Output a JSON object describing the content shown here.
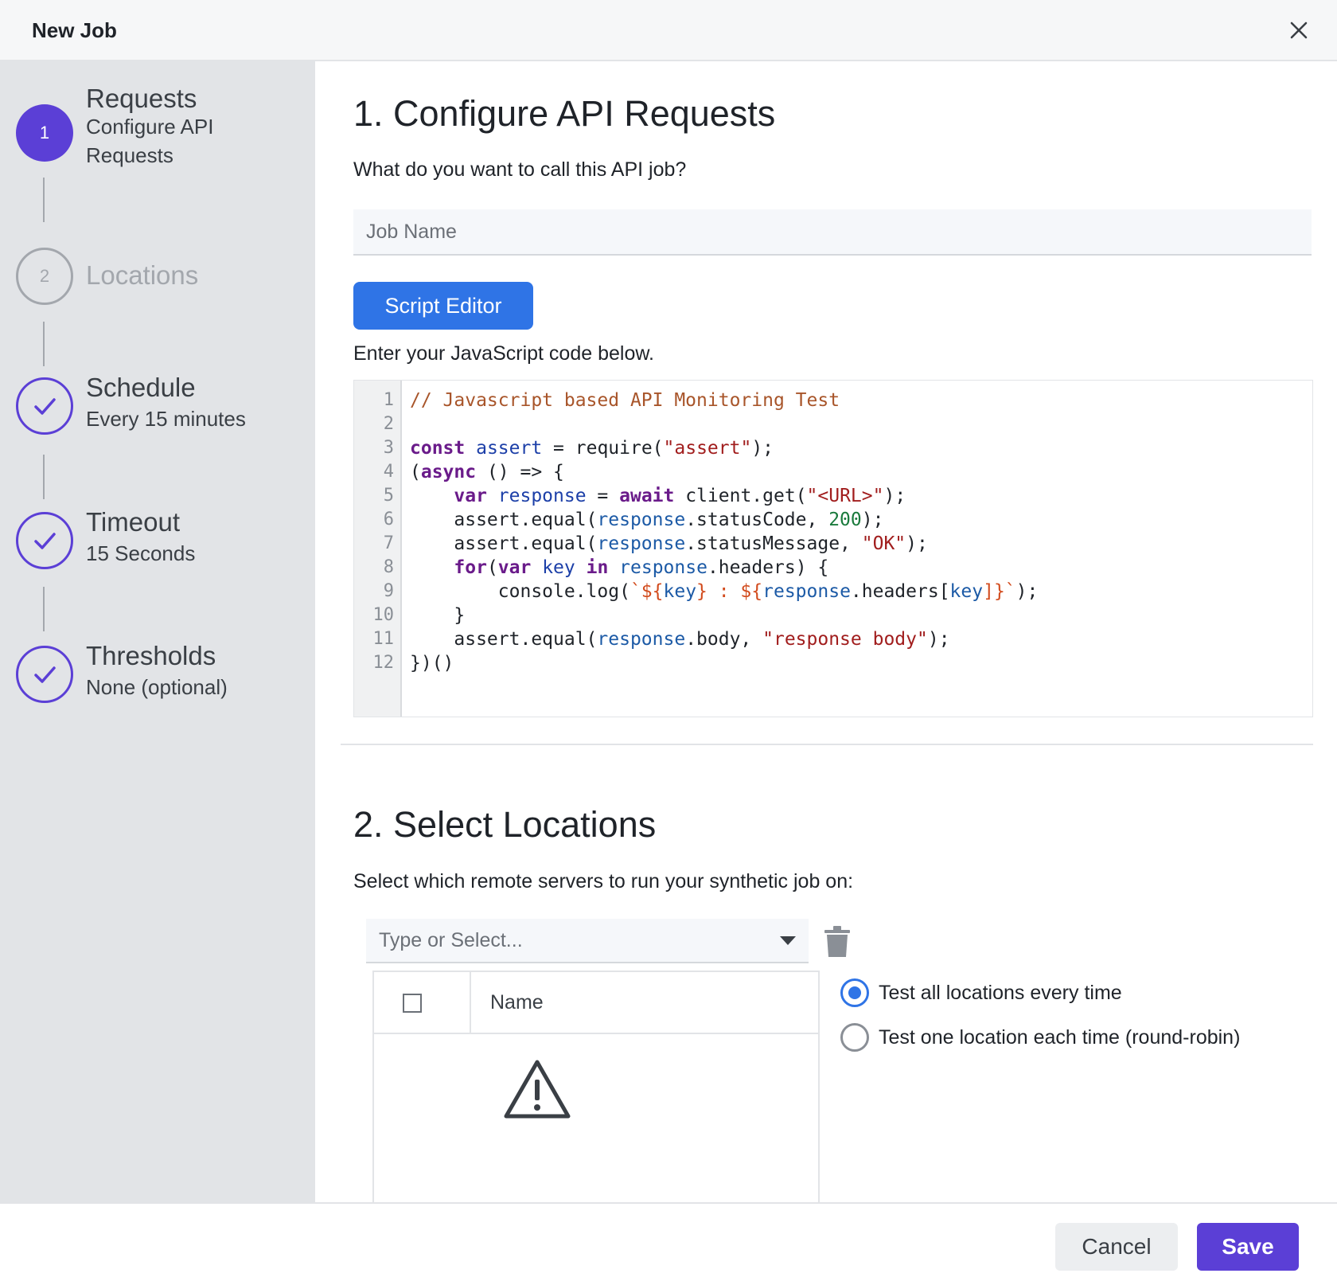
{
  "window": {
    "title": "New Job"
  },
  "steps": [
    {
      "number": "1",
      "name": "Requests",
      "sub": "Configure API Requests",
      "state": "active"
    },
    {
      "number": "2",
      "name": "Locations",
      "sub": "",
      "state": "todo"
    },
    {
      "number": "",
      "name": "Schedule",
      "sub": "Every 15 minutes",
      "state": "done"
    },
    {
      "number": "",
      "name": "Timeout",
      "sub": "15 Seconds",
      "state": "done"
    },
    {
      "number": "",
      "name": "Thresholds",
      "sub": "None (optional)",
      "state": "done"
    }
  ],
  "requests": {
    "heading": "1. Configure API Requests",
    "question": "What do you want to call this API job?",
    "job_name_placeholder": "Job Name",
    "script_editor_label": "Script Editor",
    "code_prompt": "Enter your JavaScript code below.",
    "line_numbers": [
      "1",
      "2",
      "3",
      "4",
      "5",
      "6",
      "7",
      "8",
      "9",
      "10",
      "11",
      "12"
    ],
    "code": {
      "l1": "// Javascript based API Monitoring Test",
      "l3": [
        "const",
        " ",
        "assert",
        " = require(",
        "\"assert\"",
        ");"
      ],
      "l4": [
        "(",
        "async",
        " () => {"
      ],
      "l5": [
        "    ",
        "var",
        " ",
        "response",
        " = ",
        "await",
        " client.get(",
        "\"<URL>\"",
        ");"
      ],
      "l6": [
        "    assert.equal(",
        "response",
        ".statusCode, ",
        "200",
        ");"
      ],
      "l7": [
        "    assert.equal(",
        "response",
        ".statusMessage, ",
        "\"OK\"",
        ");"
      ],
      "l8": [
        "    ",
        "for",
        "(",
        "var",
        " ",
        "key",
        " ",
        "in",
        " ",
        "response",
        ".headers) {"
      ],
      "l9": [
        "        console.log(",
        "`${",
        "key",
        "} : ${",
        "response",
        ".headers[",
        "key",
        "]}`",
        ");"
      ],
      "l10": "    }",
      "l11": [
        "    assert.equal(",
        "response",
        ".body, ",
        "\"response body\"",
        ");"
      ],
      "l12": "})()"
    }
  },
  "locations": {
    "heading": "2. Select Locations",
    "prompt": "Select which remote servers to run your synthetic job on:",
    "select_placeholder": "Type or Select...",
    "table_header_name": "Name",
    "radio_all": "Test all locations every time",
    "radio_one": "Test one location each time (round-robin)",
    "selected_mode": "all"
  },
  "footer": {
    "cancel_label": "Cancel",
    "save_label": "Save"
  },
  "colors": {
    "accent": "#5b3fd6",
    "primary_button": "#2f74e6"
  }
}
